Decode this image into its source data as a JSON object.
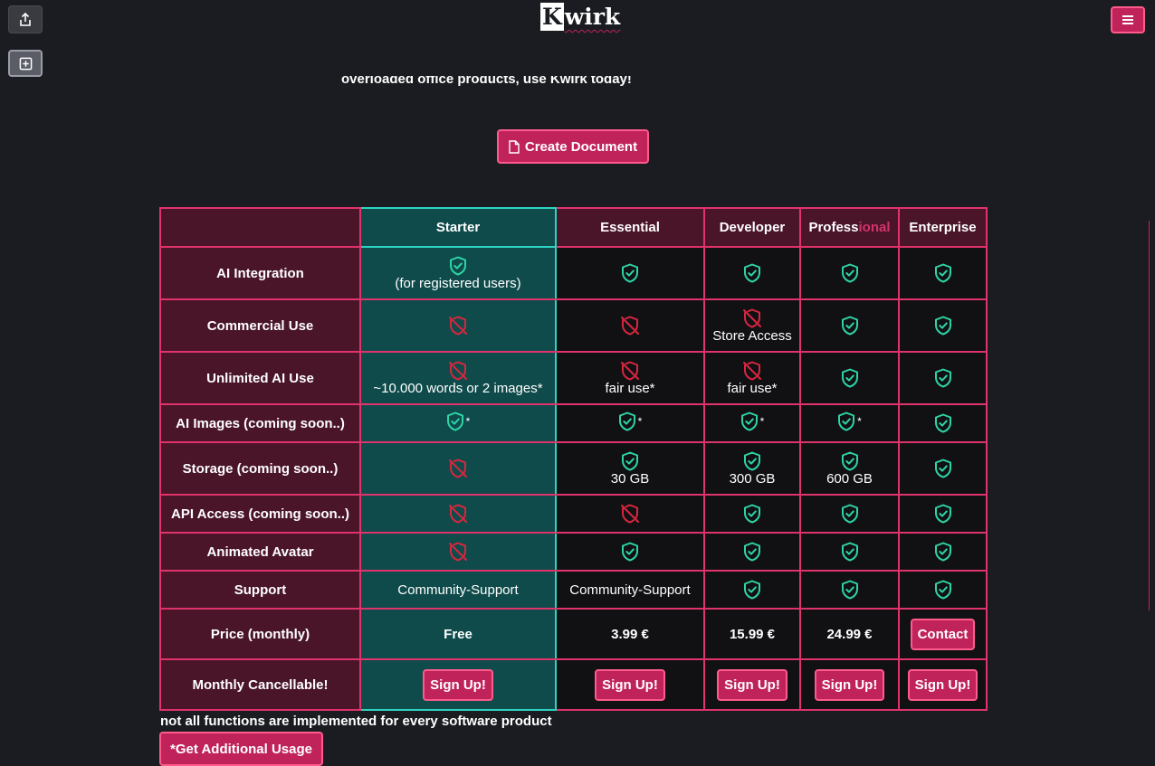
{
  "header": {
    "logo_initial": "K",
    "logo_rest": "wirk",
    "intro_text": "overloaded office products, use Kwirk today!",
    "create_button": "Create Document"
  },
  "table": {
    "columns": [
      "",
      "Starter",
      "Essential",
      "Developer",
      "Professional",
      "Enterprise"
    ],
    "professional_parts": [
      "Profess",
      "ional"
    ],
    "rows": [
      {
        "label": "AI Integration",
        "cells": [
          {
            "icon": "check",
            "note": "(for registered users)"
          },
          {
            "icon": "check"
          },
          {
            "icon": "check"
          },
          {
            "icon": "check"
          },
          {
            "icon": "check"
          }
        ]
      },
      {
        "label": "Commercial Use",
        "cells": [
          {
            "icon": "cross"
          },
          {
            "icon": "cross"
          },
          {
            "icon": "cross",
            "note": "Store Access"
          },
          {
            "icon": "check"
          },
          {
            "icon": "check"
          }
        ]
      },
      {
        "label": "Unlimited AI Use",
        "cells": [
          {
            "icon": "cross",
            "note": "~10.000 words or 2 images*"
          },
          {
            "icon": "cross",
            "note": "fair use*"
          },
          {
            "icon": "cross",
            "note": "fair use*"
          },
          {
            "icon": "check"
          },
          {
            "icon": "check"
          }
        ]
      },
      {
        "label": "AI Images (coming soon..)",
        "cells": [
          {
            "icon": "check",
            "suffix": "*"
          },
          {
            "icon": "check",
            "suffix": "*"
          },
          {
            "icon": "check",
            "suffix": "*"
          },
          {
            "icon": "check",
            "suffix": "*"
          },
          {
            "icon": "check"
          }
        ]
      },
      {
        "label": "Storage (coming soon..)",
        "cells": [
          {
            "icon": "cross"
          },
          {
            "icon": "check",
            "note": "30 GB"
          },
          {
            "icon": "check",
            "note": "300 GB"
          },
          {
            "icon": "check",
            "note": "600 GB"
          },
          {
            "icon": "check"
          }
        ]
      },
      {
        "label": "API Access (coming soon..)",
        "cells": [
          {
            "icon": "cross"
          },
          {
            "icon": "cross"
          },
          {
            "icon": "check"
          },
          {
            "icon": "check"
          },
          {
            "icon": "check"
          }
        ]
      },
      {
        "label": "Animated Avatar",
        "cells": [
          {
            "icon": "cross"
          },
          {
            "icon": "check"
          },
          {
            "icon": "check"
          },
          {
            "icon": "check"
          },
          {
            "icon": "check"
          }
        ]
      },
      {
        "label": "Support",
        "cells": [
          {
            "text": "Community-Support"
          },
          {
            "text": "Community-Support"
          },
          {
            "icon": "check"
          },
          {
            "icon": "check"
          },
          {
            "icon": "check"
          }
        ]
      },
      {
        "label": "Price (monthly)",
        "cells": [
          {
            "price": "Free"
          },
          {
            "price": "3.99 €"
          },
          {
            "price": "15.99 €"
          },
          {
            "price": "24.99 €"
          },
          {
            "button": "Contact"
          }
        ]
      },
      {
        "label": "Monthly Cancellable!",
        "cells": [
          {
            "button": "Sign Up!"
          },
          {
            "button": "Sign Up!"
          },
          {
            "button": "Sign Up!"
          },
          {
            "button": "Sign Up!"
          },
          {
            "button": "Sign Up!"
          }
        ]
      }
    ]
  },
  "footer": {
    "footnote": "not all functions are implemented for every software product",
    "additional_usage_button": "*Get Additional Usage"
  },
  "colors": {
    "background": "#1b1c21",
    "accent": "#c0235a",
    "starter_bg": "#0f4b4b",
    "check": "#2ed4a6",
    "cross": "#d8263f"
  },
  "icons": {
    "share": "share-icon",
    "add": "add-square-icon",
    "menu": "hamburger-menu-icon",
    "document": "document-icon",
    "check": "shield-check-icon",
    "cross": "shield-off-icon"
  }
}
